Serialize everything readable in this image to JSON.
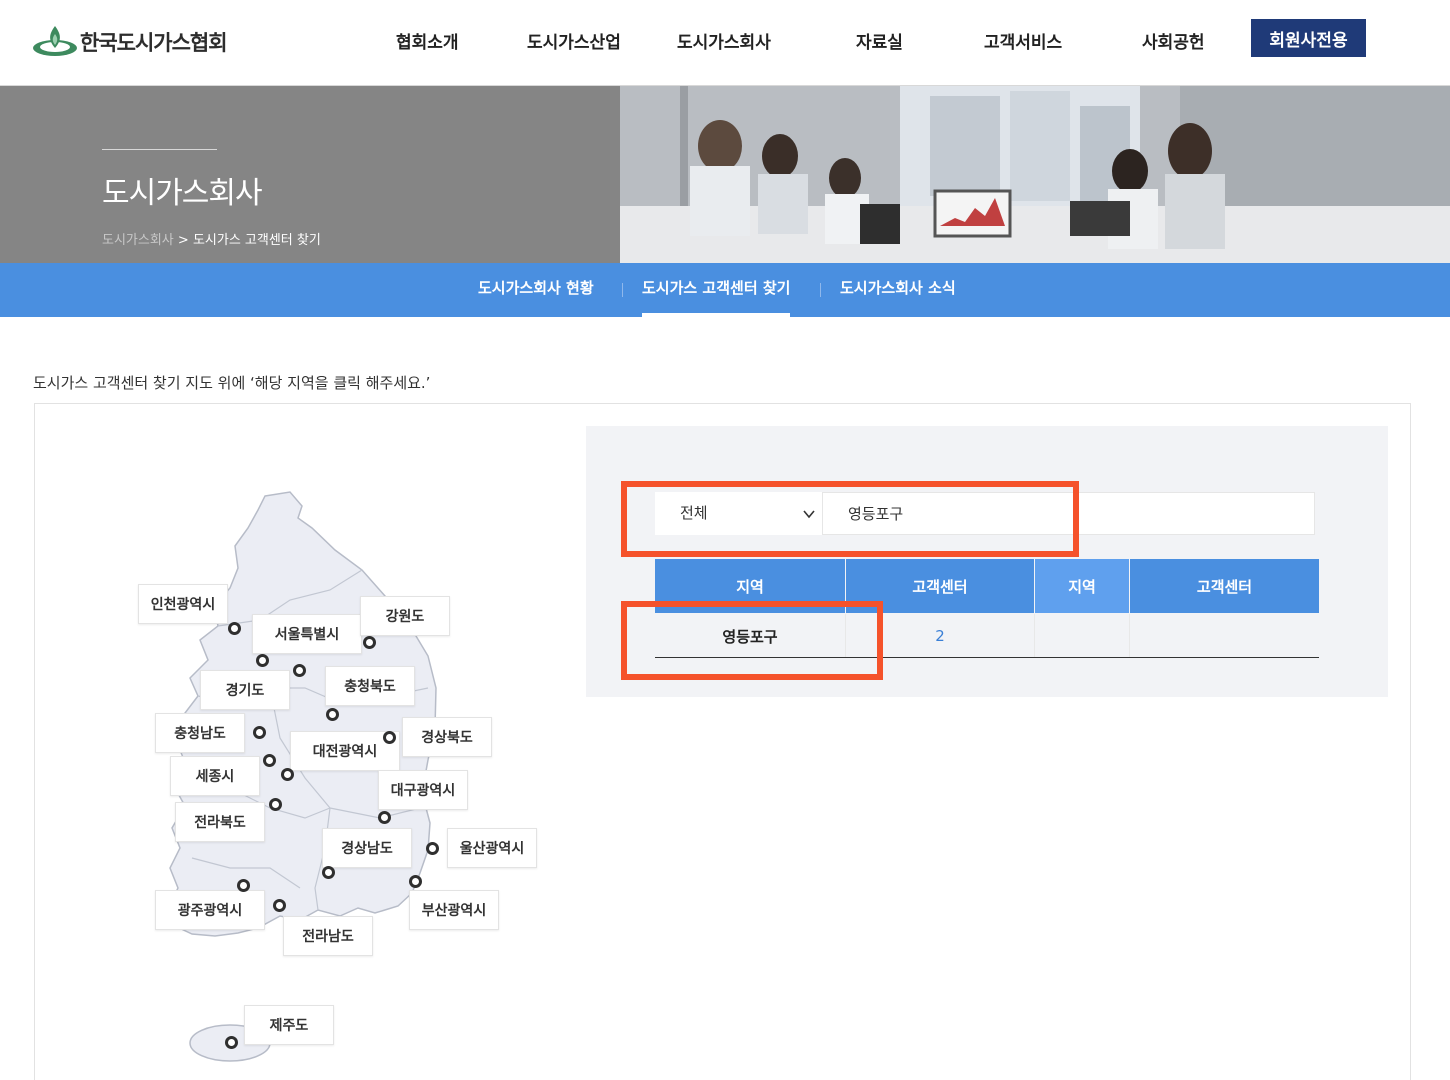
{
  "header": {
    "logo_text": "한국도시가스협회",
    "nav": [
      "협회소개",
      "도시가스산업",
      "도시가스회사",
      "자료실",
      "고객서비스",
      "사회공헌"
    ],
    "member_button": "회원사전용"
  },
  "hero": {
    "title": "도시가스회사",
    "breadcrumb_parent": "도시가스회사",
    "breadcrumb_current": "도시가스 고객센터 찾기"
  },
  "subnav": [
    "도시가스회사 현황",
    "도시가스 고객센터 찾기",
    "도시가스회사 소식"
  ],
  "instruction": "도시가스 고객센터 찾기 지도 위에 ‘해당 지역을 클릭 해주세요.’",
  "map": {
    "regions": [
      "인천광역시",
      "서울특별시",
      "강원도",
      "경기도",
      "충청북도",
      "충청남도",
      "대전광역시",
      "경상북도",
      "세종시",
      "대구광역시",
      "전라북도",
      "경상남도",
      "울산광역시",
      "광주광역시",
      "부산광역시",
      "전라남도",
      "제주도"
    ]
  },
  "search": {
    "select_value": "전체",
    "input_value": "영등포구"
  },
  "table": {
    "headers": [
      "지역",
      "고객센터",
      "지역",
      "고객센터"
    ],
    "rows": [
      [
        "영등포구",
        "2",
        "",
        ""
      ]
    ]
  },
  "colors": {
    "brand_blue": "#4a8fe0",
    "member_navy": "#1f3a78",
    "highlight": "#f5522b"
  }
}
